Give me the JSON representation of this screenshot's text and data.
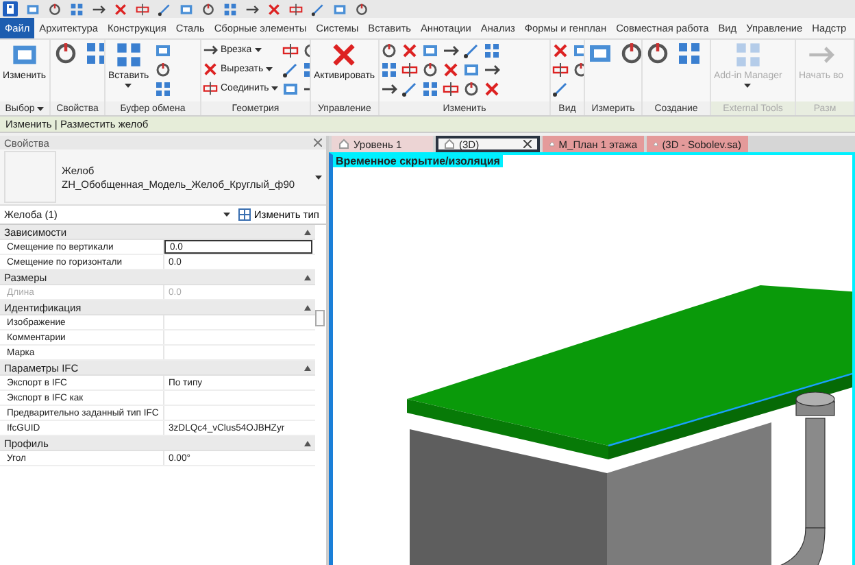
{
  "menu_tabs": [
    {
      "label": "Файл",
      "selected": true
    },
    {
      "label": "Архитектура",
      "selected": false
    },
    {
      "label": "Конструкция",
      "selected": false
    },
    {
      "label": "Сталь",
      "selected": false
    },
    {
      "label": "Сборные элементы",
      "selected": false
    },
    {
      "label": "Системы",
      "selected": false
    },
    {
      "label": "Вставить",
      "selected": false
    },
    {
      "label": "Аннотации",
      "selected": false
    },
    {
      "label": "Анализ",
      "selected": false
    },
    {
      "label": "Формы и генплан",
      "selected": false
    },
    {
      "label": "Совместная работа",
      "selected": false
    },
    {
      "label": "Вид",
      "selected": false
    },
    {
      "label": "Управление",
      "selected": false
    },
    {
      "label": "Надстр",
      "selected": false
    }
  ],
  "ribbon": [
    {
      "title": "Выбор",
      "dropdown": true,
      "disabled": false,
      "tools": [
        {
          "kind": "large",
          "label": "Изменить",
          "dropdown": false
        }
      ]
    },
    {
      "title": "Свойства",
      "dropdown": false,
      "disabled": false,
      "tools": [
        {
          "kind": "large"
        },
        {
          "kind": "large"
        }
      ]
    },
    {
      "title": "Буфер обмена",
      "dropdown": false,
      "disabled": false,
      "tools": [
        {
          "kind": "large",
          "label": "Вставить",
          "dropdown": true
        },
        {
          "kind": "icon"
        },
        {
          "kind": "icon"
        },
        {
          "kind": "icon"
        }
      ]
    },
    {
      "title": "Геометрия",
      "dropdown": false,
      "disabled": false,
      "tools": [
        {
          "kind": "small",
          "label": "Врезка",
          "dropdown": true
        },
        {
          "kind": "small",
          "label": "Вырезать",
          "dropdown": true
        },
        {
          "kind": "small",
          "label": "Соединить",
          "dropdown": true
        },
        {
          "kind": "icon"
        },
        {
          "kind": "icon"
        },
        {
          "kind": "icon"
        },
        {
          "kind": "icon"
        },
        {
          "kind": "icon"
        },
        {
          "kind": "icon"
        }
      ]
    },
    {
      "title": "Управление",
      "dropdown": false,
      "disabled": false,
      "tools": [
        {
          "kind": "large",
          "label": "Активировать",
          "dropdown": false
        }
      ]
    },
    {
      "title": "Изменить",
      "dropdown": false,
      "disabled": false,
      "tools": [
        {
          "kind": "icon"
        },
        {
          "kind": "icon"
        },
        {
          "kind": "icon"
        },
        {
          "kind": "icon"
        },
        {
          "kind": "icon"
        },
        {
          "kind": "icon"
        },
        {
          "kind": "icon"
        },
        {
          "kind": "icon"
        },
        {
          "kind": "icon"
        },
        {
          "kind": "icon"
        },
        {
          "kind": "icon"
        },
        {
          "kind": "icon"
        },
        {
          "kind": "icon"
        },
        {
          "kind": "icon"
        },
        {
          "kind": "icon"
        },
        {
          "kind": "icon"
        },
        {
          "kind": "icon"
        },
        {
          "kind": "icon"
        }
      ]
    },
    {
      "title": "Вид",
      "dropdown": false,
      "disabled": false,
      "tools": [
        {
          "kind": "icon"
        },
        {
          "kind": "icon"
        },
        {
          "kind": "icon"
        },
        {
          "kind": "icon"
        },
        {
          "kind": "icon"
        }
      ]
    },
    {
      "title": "Измерить",
      "dropdown": false,
      "disabled": false,
      "tools": [
        {
          "kind": "large"
        },
        {
          "kind": "large"
        }
      ]
    },
    {
      "title": "Создание",
      "dropdown": false,
      "disabled": false,
      "tools": [
        {
          "kind": "large"
        },
        {
          "kind": "large"
        }
      ]
    },
    {
      "title": "External Tools",
      "dropdown": false,
      "disabled": true,
      "tools": [
        {
          "kind": "large",
          "label": "Add-in Manager",
          "dropdown": true
        }
      ]
    },
    {
      "title": "Разм",
      "dropdown": false,
      "disabled": true,
      "tools": [
        {
          "kind": "large",
          "label": "Начать во",
          "dropdown": false
        }
      ]
    }
  ],
  "context_bar": "Изменить | Разместить желоб",
  "properties": {
    "title": "Свойства",
    "family": "Желоб",
    "type": "ZH_Обобщенная_Модель_Желоб_Круглый_ф90",
    "instance": "Желоба (1)",
    "edit_type": "Изменить тип",
    "groups": [
      {
        "title": "Зависимости",
        "rows": [
          {
            "label": "Смещение по вертикали",
            "value": "0.0",
            "editing": true,
            "disabled": false
          },
          {
            "label": "Смещение по горизонтали",
            "value": "0.0",
            "editing": false,
            "disabled": false
          }
        ]
      },
      {
        "title": "Размеры",
        "rows": [
          {
            "label": "Длина",
            "value": "0.0",
            "editing": false,
            "disabled": true
          }
        ]
      },
      {
        "title": "Идентификация",
        "rows": [
          {
            "label": "Изображение",
            "editing": false,
            "disabled": false
          },
          {
            "label": "Комментарии",
            "editing": false,
            "disabled": false
          },
          {
            "label": "Марка",
            "editing": false,
            "disabled": false
          }
        ]
      },
      {
        "title": "Параметры IFC",
        "rows": [
          {
            "label": "Экспорт в IFC",
            "value": "По типу",
            "editing": false,
            "disabled": false
          },
          {
            "label": "Экспорт в IFC как",
            "editing": false,
            "disabled": false
          },
          {
            "label": "Предварительно заданный тип IFC",
            "editing": false,
            "disabled": false
          },
          {
            "label": "IfcGUID",
            "value": "3zDLQc4_vClus54OJBHZyr",
            "editing": false,
            "disabled": false
          }
        ]
      },
      {
        "title": "Профиль",
        "rows": [
          {
            "label": "Угол",
            "value": "0.00°",
            "editing": false,
            "disabled": false
          }
        ]
      }
    ]
  },
  "view_tabs": [
    {
      "label": "Уровень 1",
      "selected": false,
      "color": "#ecd4d4"
    },
    {
      "label": "(3D)",
      "selected": true,
      "color": "#f4f4f4"
    },
    {
      "label": "М_План 1 этажа",
      "selected": false,
      "color": "#e49a9a"
    },
    {
      "label": "(3D - Sobolev.sa)",
      "selected": false,
      "color": "#e49a9a"
    }
  ],
  "view": {
    "banner": "Временное скрытие/изоляция"
  }
}
